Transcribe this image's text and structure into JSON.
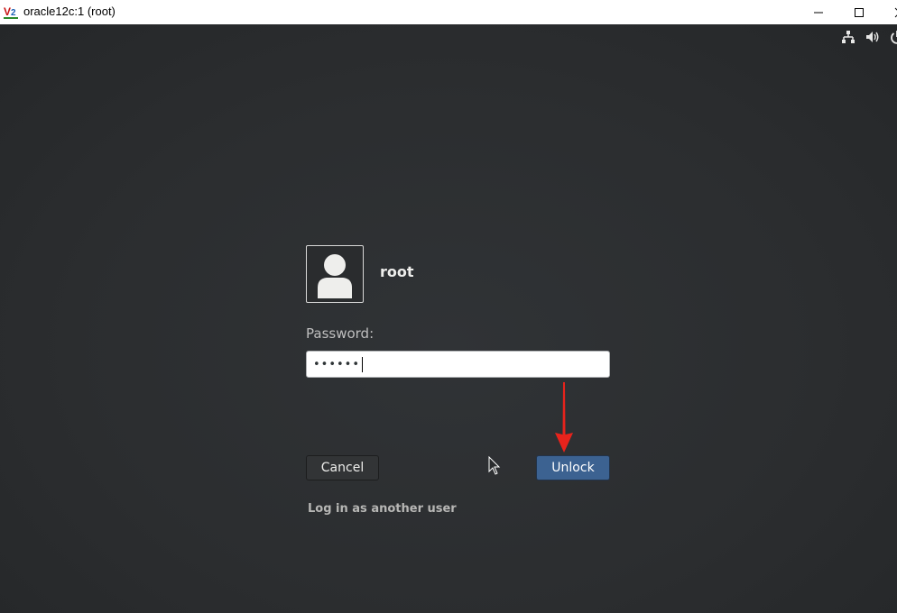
{
  "window": {
    "title": "oracle12c:1 (root)",
    "app_icon": "vnc-viewer-icon",
    "controls": [
      "minimize-icon",
      "maximize-icon",
      "close-icon"
    ]
  },
  "tray": {
    "icons": [
      "network-icon",
      "volume-icon",
      "power-icon"
    ]
  },
  "login": {
    "username": "root",
    "avatar_icon": "user-avatar-icon",
    "password_label": "Password:",
    "password_value": "••••••",
    "cancel_label": "Cancel",
    "unlock_label": "Unlock",
    "other_user_label": "Log in as another user"
  },
  "colors": {
    "background": "#2a2c2e",
    "unlock_button": "#3c6291",
    "annotation_arrow": "#e8231c"
  }
}
